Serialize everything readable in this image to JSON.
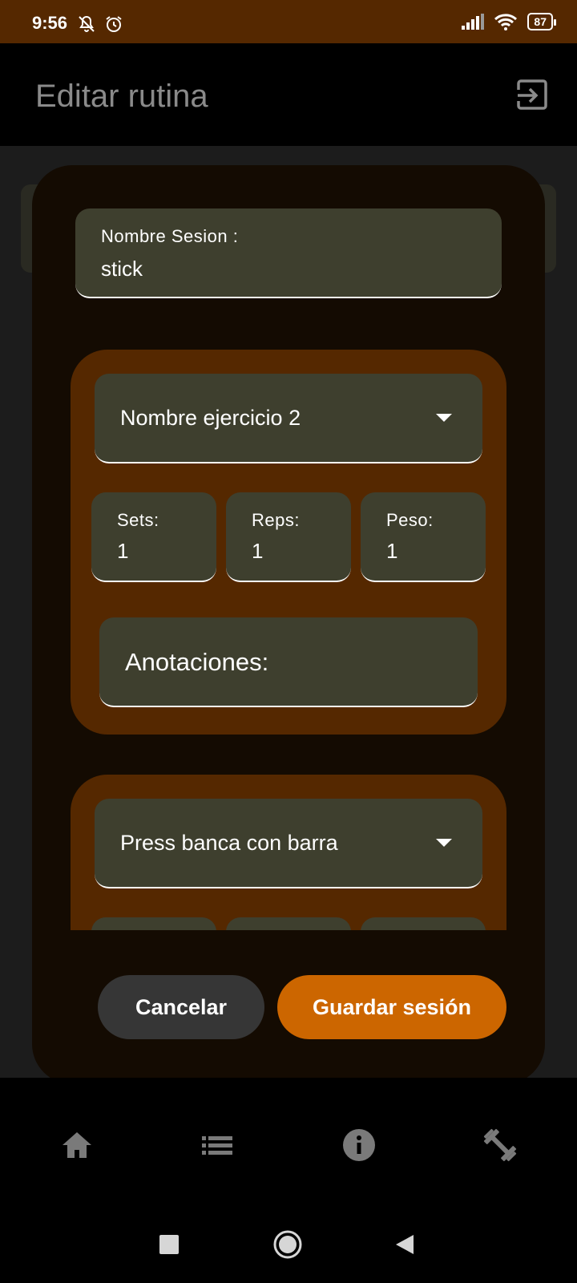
{
  "status_bar": {
    "time": "9:56",
    "battery": "87"
  },
  "app_bar": {
    "title": "Editar rutina"
  },
  "form": {
    "session_label": "Nombre Sesion :",
    "session_value": "stick",
    "exercises": [
      {
        "name": "Nombre ejercicio 2",
        "sets_label": "Sets:",
        "sets_value": "1",
        "reps_label": "Reps:",
        "reps_value": "1",
        "peso_label": "Peso:",
        "peso_value": "1",
        "notes_label": "Anotaciones:"
      },
      {
        "name": "Press banca con barra"
      }
    ]
  },
  "actions": {
    "cancel_label": "Cancelar",
    "save_label": "Guardar sesión"
  },
  "bottom_nav": {
    "items": [
      "home-icon",
      "list-icon",
      "info-icon",
      "dumbbell-icon"
    ]
  },
  "colors": {
    "status_bar": "#552800",
    "card": "#552800",
    "field": "#3e3f2e",
    "save_button": "#cc6600",
    "cancel_button": "#363636"
  }
}
